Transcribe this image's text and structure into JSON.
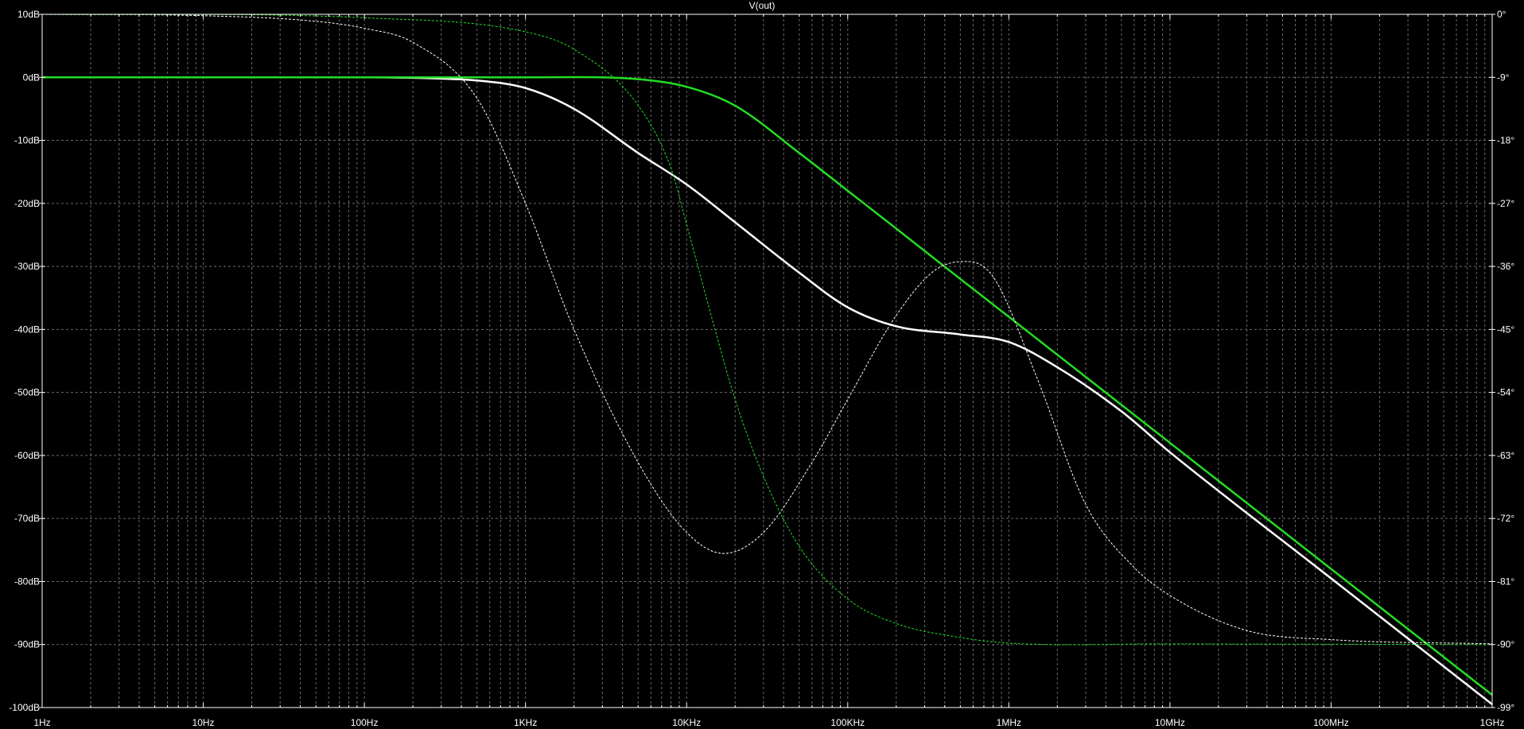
{
  "chart_data": {
    "type": "line",
    "title": "V(out)",
    "x_scale": "log",
    "xlim": [
      1,
      1000000000
    ],
    "ylim_left": [
      -100,
      10
    ],
    "ylim_right": [
      -99,
      0
    ],
    "x_ticks": [
      {
        "v": 1,
        "label": "1Hz"
      },
      {
        "v": 10,
        "label": "10Hz"
      },
      {
        "v": 100,
        "label": "100Hz"
      },
      {
        "v": 1000,
        "label": "1KHz"
      },
      {
        "v": 10000,
        "label": "10KHz"
      },
      {
        "v": 100000,
        "label": "100KHz"
      },
      {
        "v": 1000000,
        "label": "1MHz"
      },
      {
        "v": 10000000,
        "label": "10MHz"
      },
      {
        "v": 100000000,
        "label": "100MHz"
      },
      {
        "v": 1000000000,
        "label": "1GHz"
      }
    ],
    "y_ticks_left": [
      {
        "v": 10,
        "label": "10dB"
      },
      {
        "v": 0,
        "label": "0dB"
      },
      {
        "v": -10,
        "label": "-10dB"
      },
      {
        "v": -20,
        "label": "-20dB"
      },
      {
        "v": -30,
        "label": "-30dB"
      },
      {
        "v": -40,
        "label": "-40dB"
      },
      {
        "v": -50,
        "label": "-50dB"
      },
      {
        "v": -60,
        "label": "-60dB"
      },
      {
        "v": -70,
        "label": "-70dB"
      },
      {
        "v": -80,
        "label": "-80dB"
      },
      {
        "v": -90,
        "label": "-90dB"
      },
      {
        "v": -100,
        "label": "-100dB"
      }
    ],
    "y_ticks_right": [
      {
        "v": 0,
        "label": "0°"
      },
      {
        "v": -9,
        "label": "-9°"
      },
      {
        "v": -18,
        "label": "-18°"
      },
      {
        "v": -27,
        "label": "-27°"
      },
      {
        "v": -36,
        "label": "-36°"
      },
      {
        "v": -45,
        "label": "-45°"
      },
      {
        "v": -54,
        "label": "-54°"
      },
      {
        "v": -63,
        "label": "-63°"
      },
      {
        "v": -72,
        "label": "-72°"
      },
      {
        "v": -81,
        "label": "-81°"
      },
      {
        "v": -90,
        "label": "-90°"
      },
      {
        "v": -99,
        "label": "-99°"
      }
    ],
    "grid": true,
    "colors": {
      "background": "#000000",
      "grid": "#6a6a6a",
      "axis": "#ffffff",
      "white_trace": "#ffffff",
      "green_trace": "#22dd22"
    },
    "series": [
      {
        "axis": "left",
        "color": "#ffffff",
        "style": "solid",
        "x": [
          1,
          100,
          300,
          500,
          1000,
          2000,
          5000,
          10000,
          20000,
          50000,
          100000,
          200000,
          500000,
          1000000,
          2000000,
          5000000,
          10000000,
          100000000,
          1000000000
        ],
        "y": [
          0,
          0,
          -0.2,
          -0.5,
          -1.7,
          -5,
          -12,
          -17,
          -23,
          -31,
          -36.5,
          -39.5,
          -40.8,
          -42,
          -46,
          -53,
          -59.5,
          -79.5,
          -99.5
        ]
      },
      {
        "axis": "left",
        "color": "#22dd22",
        "style": "solid",
        "x": [
          1,
          1000,
          5000,
          10000,
          20000,
          50000,
          100000,
          200000,
          500000,
          1000000,
          10000000,
          100000000,
          1000000000
        ],
        "y": [
          0,
          0,
          -0.3,
          -1.5,
          -4.5,
          -12,
          -18,
          -24,
          -32,
          -38,
          -58,
          -78,
          -98
        ]
      },
      {
        "axis": "right",
        "color": "#ffffff",
        "style": "dashed",
        "x": [
          1,
          10,
          50,
          100,
          200,
          500,
          1000,
          2000,
          5000,
          10000,
          17000,
          30000,
          60000,
          100000,
          200000,
          350000,
          550000,
          800000,
          1500000,
          3000000,
          6000000,
          10000000,
          30000000,
          100000000,
          1000000000
        ],
        "y": [
          0,
          -0.2,
          -1,
          -2,
          -4,
          -12,
          -27,
          -45,
          -64,
          -74,
          -77,
          -74,
          -64,
          -55,
          -43,
          -36.5,
          -35.3,
          -37.5,
          -52,
          -70,
          -79,
          -83,
          -88,
          -89.3,
          -89.9
        ]
      },
      {
        "axis": "right",
        "color": "#22dd22",
        "style": "dashed",
        "x": [
          1,
          100,
          1000,
          2000,
          5000,
          8000,
          10000,
          15000,
          20000,
          30000,
          50000,
          100000,
          200000,
          500000,
          1000000,
          10000000,
          1000000000
        ],
        "y": [
          0,
          -0.5,
          -2.5,
          -5,
          -13,
          -22,
          -30,
          -45,
          -55,
          -66,
          -76,
          -83.5,
          -87,
          -89,
          -89.8,
          -89.9,
          -90
        ]
      }
    ]
  }
}
